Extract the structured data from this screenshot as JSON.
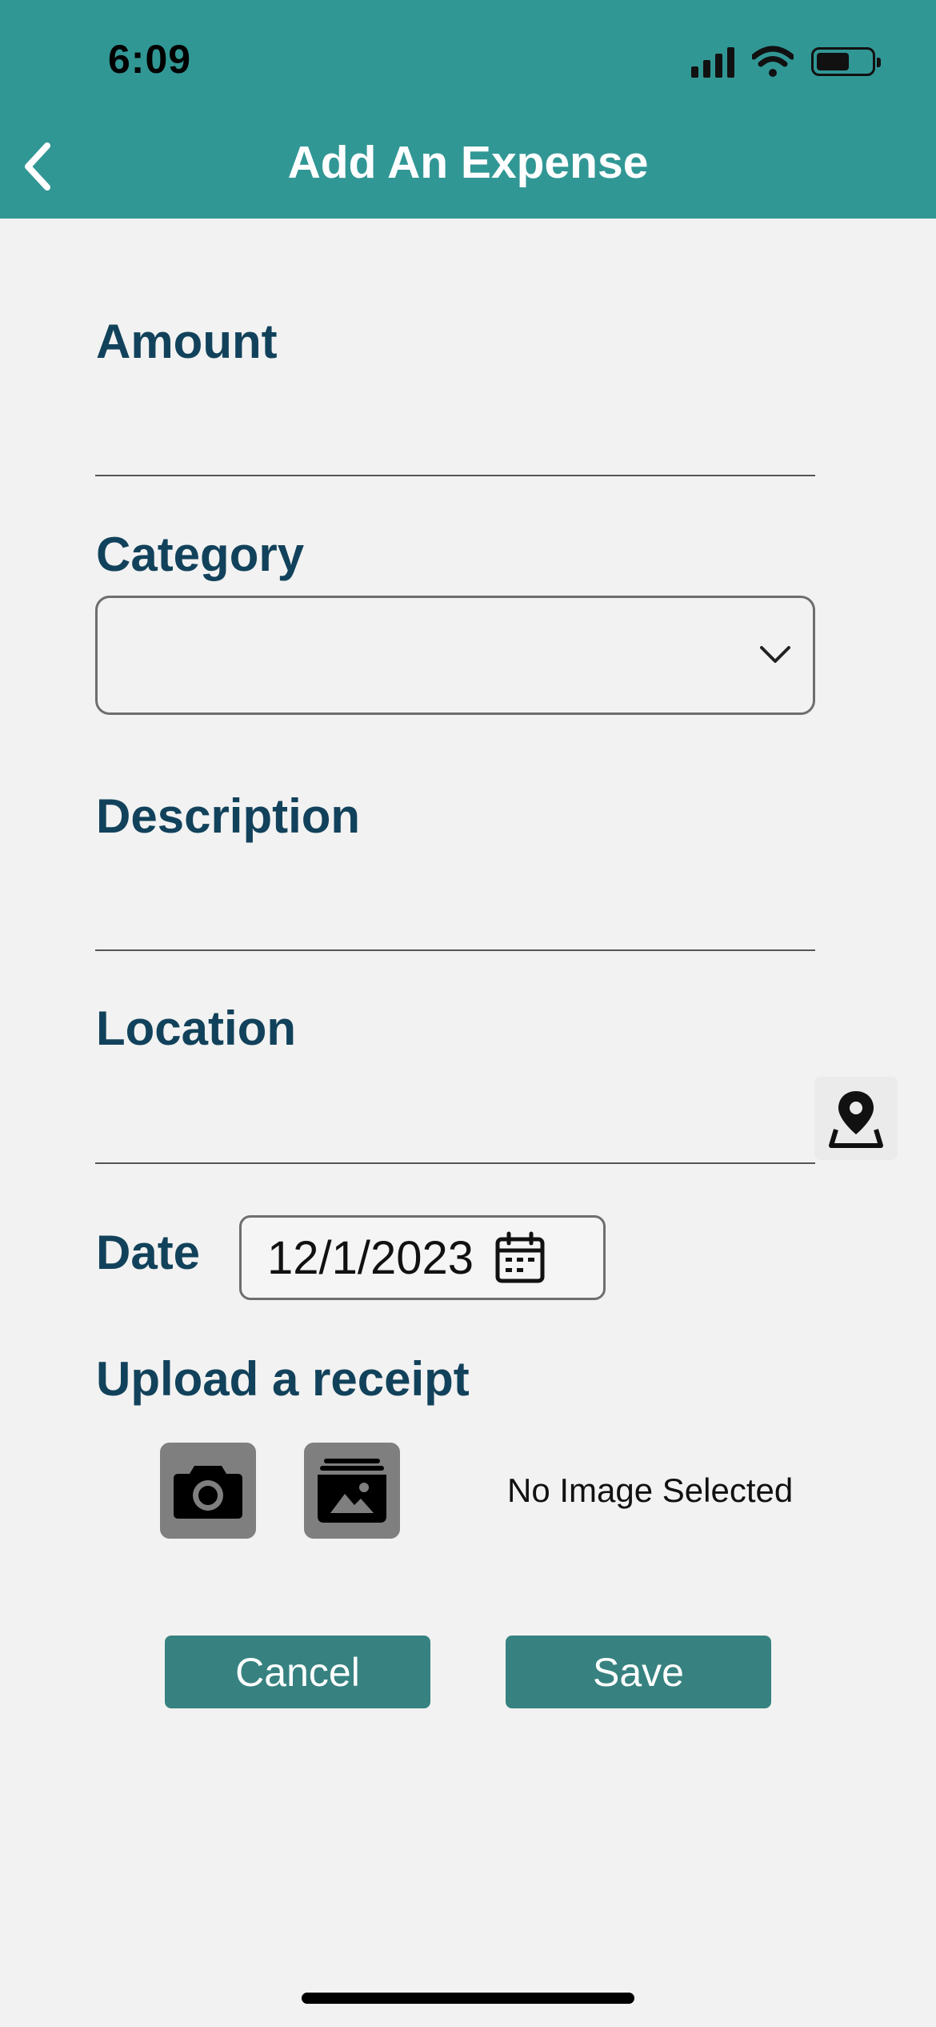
{
  "status_bar": {
    "time": "6:09"
  },
  "header": {
    "title": "Add An Expense",
    "background_color": "#319795"
  },
  "form": {
    "amount_label": "Amount",
    "amount_value": "",
    "category_label": "Category",
    "category_value": "",
    "description_label": "Description",
    "description_value": "",
    "location_label": "Location",
    "location_value": "",
    "date_label": "Date",
    "date_value": "12/1/2023",
    "upload_label": "Upload a receipt",
    "no_image_text": "No Image Selected"
  },
  "actions": {
    "cancel_label": "Cancel",
    "save_label": "Save",
    "button_color": "#378280"
  },
  "icons": [
    "chevron-left-icon",
    "chevron-down-icon",
    "location-pin-icon",
    "calendar-icon",
    "camera-icon",
    "gallery-icon"
  ],
  "colors": {
    "label": "#12425b",
    "background": "#f2f2f2"
  }
}
